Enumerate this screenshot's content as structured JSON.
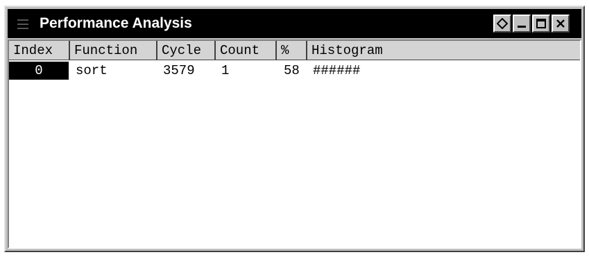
{
  "window": {
    "title": "Performance Analysis",
    "buttons": {
      "pin": "pin-icon",
      "minimize": "minimize-icon",
      "maximize": "maximize-icon",
      "close": "close-icon"
    }
  },
  "table": {
    "columns": [
      "Index",
      "Function",
      "Cycle",
      "Count",
      "%",
      "Histogram"
    ],
    "rows": [
      {
        "index": "0",
        "function": "sort",
        "cycle": "3579",
        "count": "1",
        "percent": "58",
        "histogram": "######"
      }
    ]
  },
  "colors": {
    "titlebar": "#000000",
    "frame": "#c0c0c0",
    "header": "#d4d4d4",
    "selected_cell": "#000000"
  }
}
